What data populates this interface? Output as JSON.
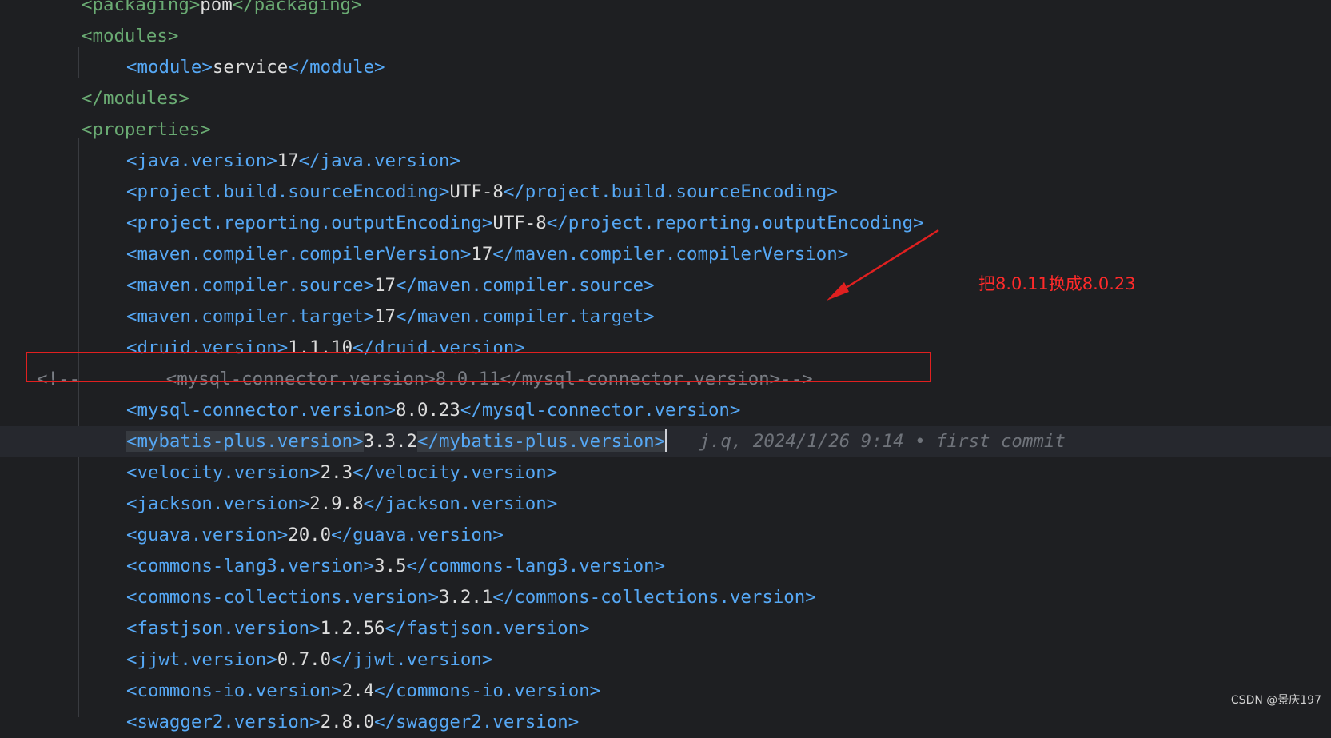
{
  "code_lines": [
    {
      "indent": 1,
      "open": "<packaging>",
      "value": "pom",
      "close": "</packaging>",
      "color": "green"
    },
    {
      "indent": 1,
      "open": "<modules>",
      "value": "",
      "close": "",
      "color": "green"
    },
    {
      "indent": 2,
      "open": "<module>",
      "value": "service",
      "close": "</module>",
      "color": "blue"
    },
    {
      "indent": 1,
      "open": "</modules>",
      "value": "",
      "close": "",
      "color": "green"
    },
    {
      "indent": 1,
      "open": "<properties>",
      "value": "",
      "close": "",
      "color": "green"
    },
    {
      "indent": 2,
      "open": "<java.version>",
      "value": "17",
      "close": "</java.version>",
      "color": "blue"
    },
    {
      "indent": 2,
      "open": "<project.build.sourceEncoding>",
      "value": "UTF-8",
      "close": "</project.build.sourceEncoding>",
      "color": "blue"
    },
    {
      "indent": 2,
      "open": "<project.reporting.outputEncoding>",
      "value": "UTF-8",
      "close": "</project.reporting.outputEncoding>",
      "color": "blue"
    },
    {
      "indent": 2,
      "open": "<maven.compiler.compilerVersion>",
      "value": "17",
      "close": "</maven.compiler.compilerVersion>",
      "color": "blue"
    },
    {
      "indent": 2,
      "open": "<maven.compiler.source>",
      "value": "17",
      "close": "</maven.compiler.source>",
      "color": "blue"
    },
    {
      "indent": 2,
      "open": "<maven.compiler.target>",
      "value": "17",
      "close": "</maven.compiler.target>",
      "color": "blue"
    },
    {
      "indent": 2,
      "open": "<druid.version>",
      "value": "1.1.10",
      "close": "</druid.version>",
      "color": "blue"
    },
    {
      "indent": 0,
      "comment": "<!--        <mysql-connector.version>8.0.11</mysql-connector.version>-->",
      "color": "comment"
    },
    {
      "indent": 2,
      "open": "<mysql-connector.version>",
      "value": "8.0.23",
      "close": "</mysql-connector.version>",
      "color": "blue"
    },
    {
      "indent": 2,
      "open": "<mybatis-plus.version>",
      "value": "3.3.2",
      "close": "</mybatis-plus.version>",
      "color": "blue",
      "current": true,
      "blame": "j.q, 2024/1/26 9:14 • first commit"
    },
    {
      "indent": 2,
      "open": "<velocity.version>",
      "value": "2.3",
      "close": "</velocity.version>",
      "color": "blue"
    },
    {
      "indent": 2,
      "open": "<jackson.version>",
      "value": "2.9.8",
      "close": "</jackson.version>",
      "color": "blue"
    },
    {
      "indent": 2,
      "open": "<guava.version>",
      "value": "20.0",
      "close": "</guava.version>",
      "color": "blue"
    },
    {
      "indent": 2,
      "open": "<commons-lang3.version>",
      "value": "3.5",
      "close": "</commons-lang3.version>",
      "color": "blue"
    },
    {
      "indent": 2,
      "open": "<commons-collections.version>",
      "value": "3.2.1",
      "close": "</commons-collections.version>",
      "color": "blue"
    },
    {
      "indent": 2,
      "open": "<fastjson.version>",
      "value": "1.2.56",
      "close": "</fastjson.version>",
      "color": "blue"
    },
    {
      "indent": 2,
      "open": "<jjwt.version>",
      "value": "0.7.0",
      "close": "</jjwt.version>",
      "color": "blue"
    },
    {
      "indent": 2,
      "open": "<commons-io.version>",
      "value": "2.4",
      "close": "</commons-io.version>",
      "color": "blue"
    },
    {
      "indent": 2,
      "open": "<swagger2.version>",
      "value": "2.8.0",
      "close": "</swagger2.version>",
      "color": "blue"
    }
  ],
  "annotation": {
    "text": "把8.0.11换成8.0.23",
    "color": "#ff2a2a"
  },
  "colors": {
    "background": "#1e1f22",
    "tag_green": "#6aab73",
    "tag_blue": "#56a8f5",
    "value": "#dcdcdc",
    "comment": "#7a7e85",
    "highlight_box": "#e02020"
  },
  "watermark": "CSDN @景庆197"
}
